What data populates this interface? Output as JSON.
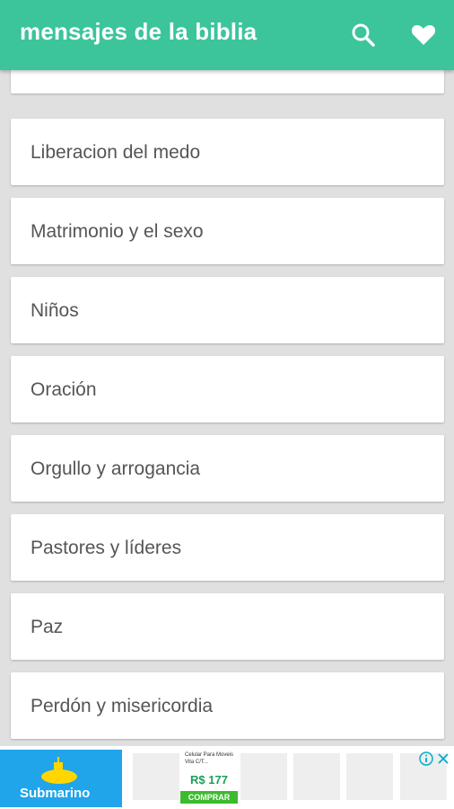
{
  "app": {
    "title": "mensajes de la biblia",
    "search_icon": "search-icon",
    "favorites_icon": "heart-icon",
    "accent_color": "#3cc49b"
  },
  "list": {
    "partial_top_item": "",
    "items": [
      "Liberacion del medo",
      "Matrimonio y el sexo",
      "Niños",
      "Oración",
      "Orgullo y arrogancia",
      "Pastores y líderes",
      "Paz",
      "Perdón y misericordia"
    ]
  },
  "ad": {
    "brand": "Submarino",
    "description": "Celular Para Moveis Vita C/T...",
    "price": "R$ 177",
    "cta": "COMPRAR"
  }
}
